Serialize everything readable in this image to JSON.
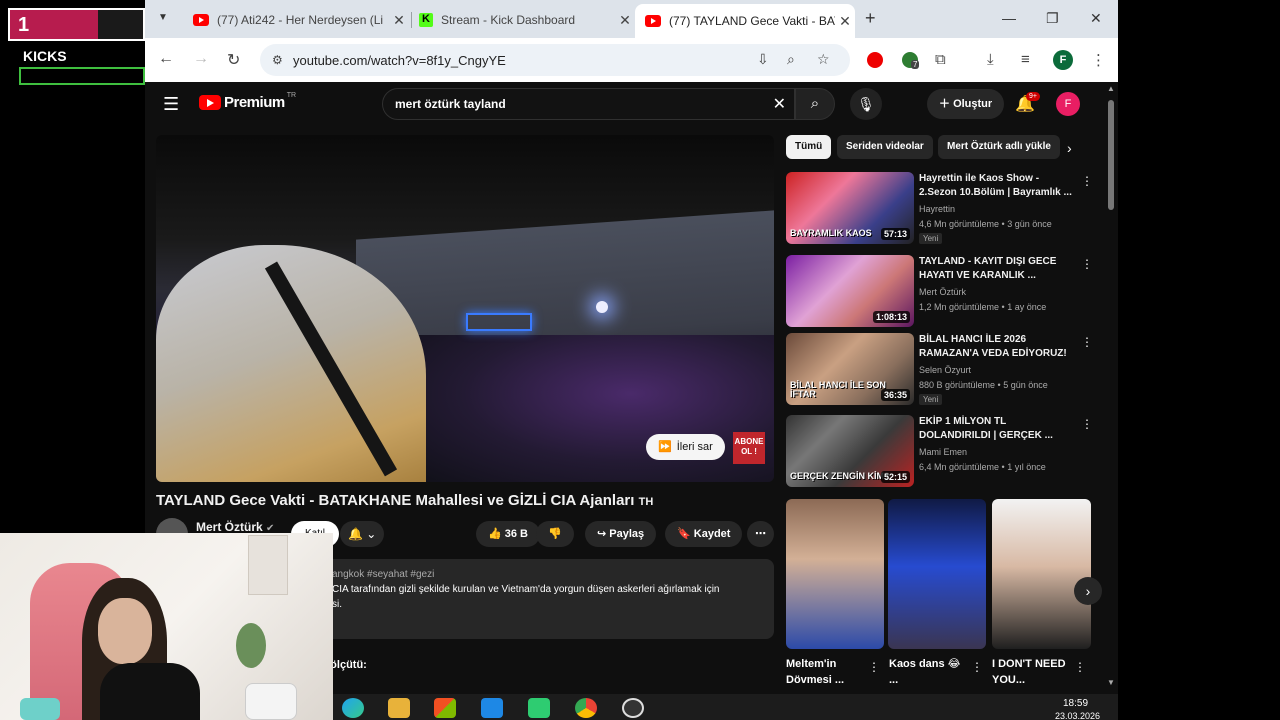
{
  "overlay": {
    "counter": "1",
    "kicks_label": "KICKS"
  },
  "browser": {
    "tabs": [
      {
        "title": "(77) Ati242 - Her Nerdeysen (Li",
        "icon": "youtube-icon"
      },
      {
        "title": "Stream - Kick Dashboard",
        "icon": "kick-icon"
      },
      {
        "title": "(77) TAYLAND Gece Vakti - BATA",
        "icon": "youtube-icon",
        "active": true
      }
    ],
    "url": "youtube.com/watch?v=8f1y_CngyYE",
    "profile_initial": "F",
    "ext_count": "7"
  },
  "youtube": {
    "logo_text": "Premium",
    "logo_region": "TR",
    "search_value": "mert öztürk tayland",
    "create_label": "Oluştur",
    "notif_badge": "9+",
    "avatar_initial": "F",
    "video": {
      "skip_label": "İleri sar",
      "abone_label": "ABONE OL !",
      "title": "TAYLAND Gece Vakti - BATAKHANE Mahallesi ve GİZLİ CIA Ajanları",
      "title_badge": "TH",
      "channel": "Mert Öztürk",
      "join_label": "Katıl",
      "likes": "36 B",
      "share_label": "Paylaş",
      "save_label": "Kaydet",
      "desc_tags": "angkok #seyahat #gezi",
      "desc_line1": "CIA tarafından gizli şekilde kurulan ve Vietnam'da yorgun düşen askerleri ağırlamak için",
      "desc_line2": "si.",
      "below_text": "a ölçütü:"
    },
    "chips": [
      "Tümü",
      "Seriden videolar",
      "Mert Öztürk adlı yükle"
    ],
    "recommendations": [
      {
        "title": "Hayrettin ile Kaos Show - 2.Sezon 10.Bölüm | Bayramlık ...",
        "channel": "Hayrettin",
        "meta": "4,6 Mn görüntüleme • 3 gün önce",
        "badge": "Yeni",
        "duration": "57:13",
        "caption": "BAYRAMLIK KAOS"
      },
      {
        "title": "TAYLAND - KAYIT DIŞI GECE HAYATI VE KARANLIK ...",
        "channel": "Mert Öztürk",
        "meta": "1,2 Mn görüntüleme • 1 ay önce",
        "badge": "",
        "duration": "1:08:13",
        "caption": ""
      },
      {
        "title": "BİLAL HANCI İLE 2026 RAMAZAN'A VEDA EDİYORUZ!",
        "channel": "Selen Özyurt",
        "meta": "880 B görüntüleme • 5 gün önce",
        "badge": "Yeni",
        "duration": "36:35",
        "caption": "BİLAL HANCI İLE SON İFTAR"
      },
      {
        "title": "EKİP 1 MİLYON TL DOLANDIRILDI | GERÇEK ...",
        "channel": "Mami Emen",
        "meta": "6,4 Mn görüntüleme • 1 yıl önce",
        "badge": "",
        "duration": "52:15",
        "caption": "GERÇEK ZENGİN KİM?"
      }
    ],
    "shorts": [
      {
        "title": "Meltem'in Dövmesi ..."
      },
      {
        "title": "Kaos dans 😂 ..."
      },
      {
        "title": "I DON'T NEED YOU..."
      }
    ]
  },
  "taskbar": {
    "time": "18:59",
    "date": "23.03.2026"
  }
}
